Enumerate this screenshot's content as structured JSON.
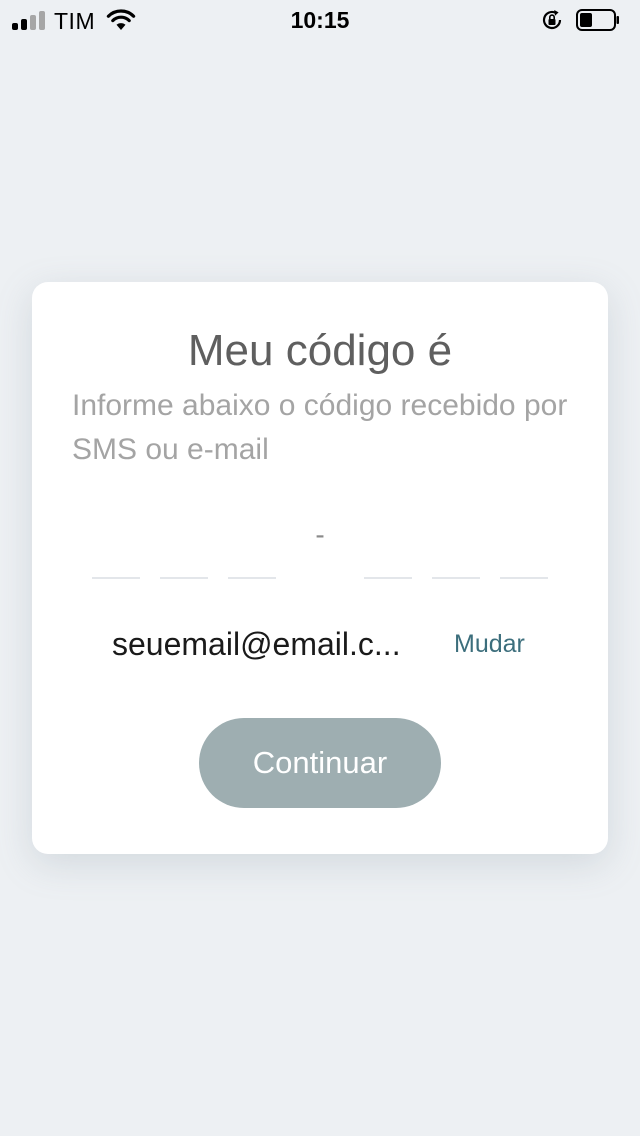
{
  "status_bar": {
    "carrier": "TIM",
    "time": "10:15"
  },
  "card": {
    "title": "Meu código é",
    "subtitle": "Informe abaixo o código recebido por SMS ou e-mail",
    "code_separator": "-",
    "email": "seuemail@email.c...",
    "change_label": "Mudar",
    "continue_label": "Continuar"
  },
  "colors": {
    "background": "#edf0f3",
    "card": "#ffffff",
    "button": "#9eaeb1",
    "link": "#3c6e7c"
  }
}
